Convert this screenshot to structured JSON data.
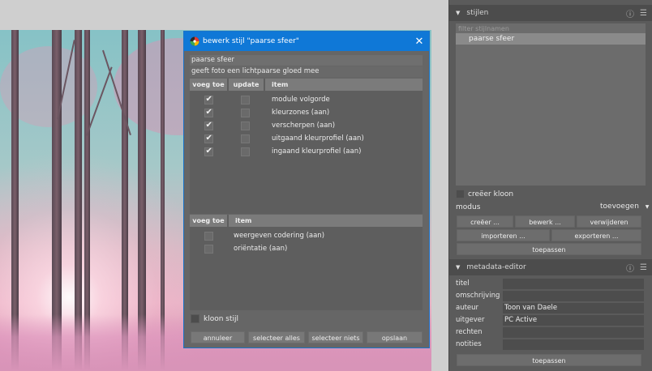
{
  "dialog": {
    "title": "bewerk stijl \"paarse sfeer\"",
    "name_value": "paarse sfeer",
    "description_value": "geeft foto een lichtpaarse gloed mee",
    "table1": {
      "headers": [
        "voeg toe",
        "update",
        "item"
      ],
      "rows": [
        {
          "label": "module volgorde",
          "include": true,
          "update": false
        },
        {
          "label": "kleurzones (aan)",
          "include": true,
          "update": false
        },
        {
          "label": "verscherpen (aan)",
          "include": true,
          "update": false
        },
        {
          "label": "uitgaand kleurprofiel (aan)",
          "include": true,
          "update": false
        },
        {
          "label": "ingaand kleurprofiel (aan)",
          "include": true,
          "update": false
        }
      ]
    },
    "table2": {
      "headers": [
        "voeg toe",
        "item"
      ],
      "rows": [
        {
          "label": "weergeven codering (aan)",
          "include": false
        },
        {
          "label": "oriëntatie (aan)",
          "include": false
        }
      ]
    },
    "clone_label": "kloon stijl",
    "buttons": {
      "cancel": "annuleer",
      "select_all": "selecteer alles",
      "select_none": "selecteer niets",
      "save": "opslaan"
    }
  },
  "styles_panel": {
    "title": "stijlen",
    "filter_placeholder": "filter stijlnamen",
    "selected_style": "paarse sfeer",
    "create_clone_label": "creëer kloon",
    "mode_label": "modus",
    "mode_value": "toevoegen",
    "buttons": {
      "create": "creëer ...",
      "edit": "bewerk ...",
      "delete": "verwijderen",
      "import": "importeren ...",
      "export": "exporteren ...",
      "apply": "toepassen"
    }
  },
  "metadata_panel": {
    "title": "metadata-editor",
    "fields": [
      {
        "label": "titel",
        "value": ""
      },
      {
        "label": "omschrijving",
        "value": ""
      },
      {
        "label": "auteur",
        "value": "Toon van Daele"
      },
      {
        "label": "uitgever",
        "value": "PC Active"
      },
      {
        "label": "rechten",
        "value": ""
      },
      {
        "label": "notities",
        "value": ""
      }
    ],
    "apply": "toepassen"
  },
  "colors": {
    "titlebar": "#0f78d7",
    "dialog_bg": "#666666",
    "panel_bg": "#5b5b5b"
  }
}
